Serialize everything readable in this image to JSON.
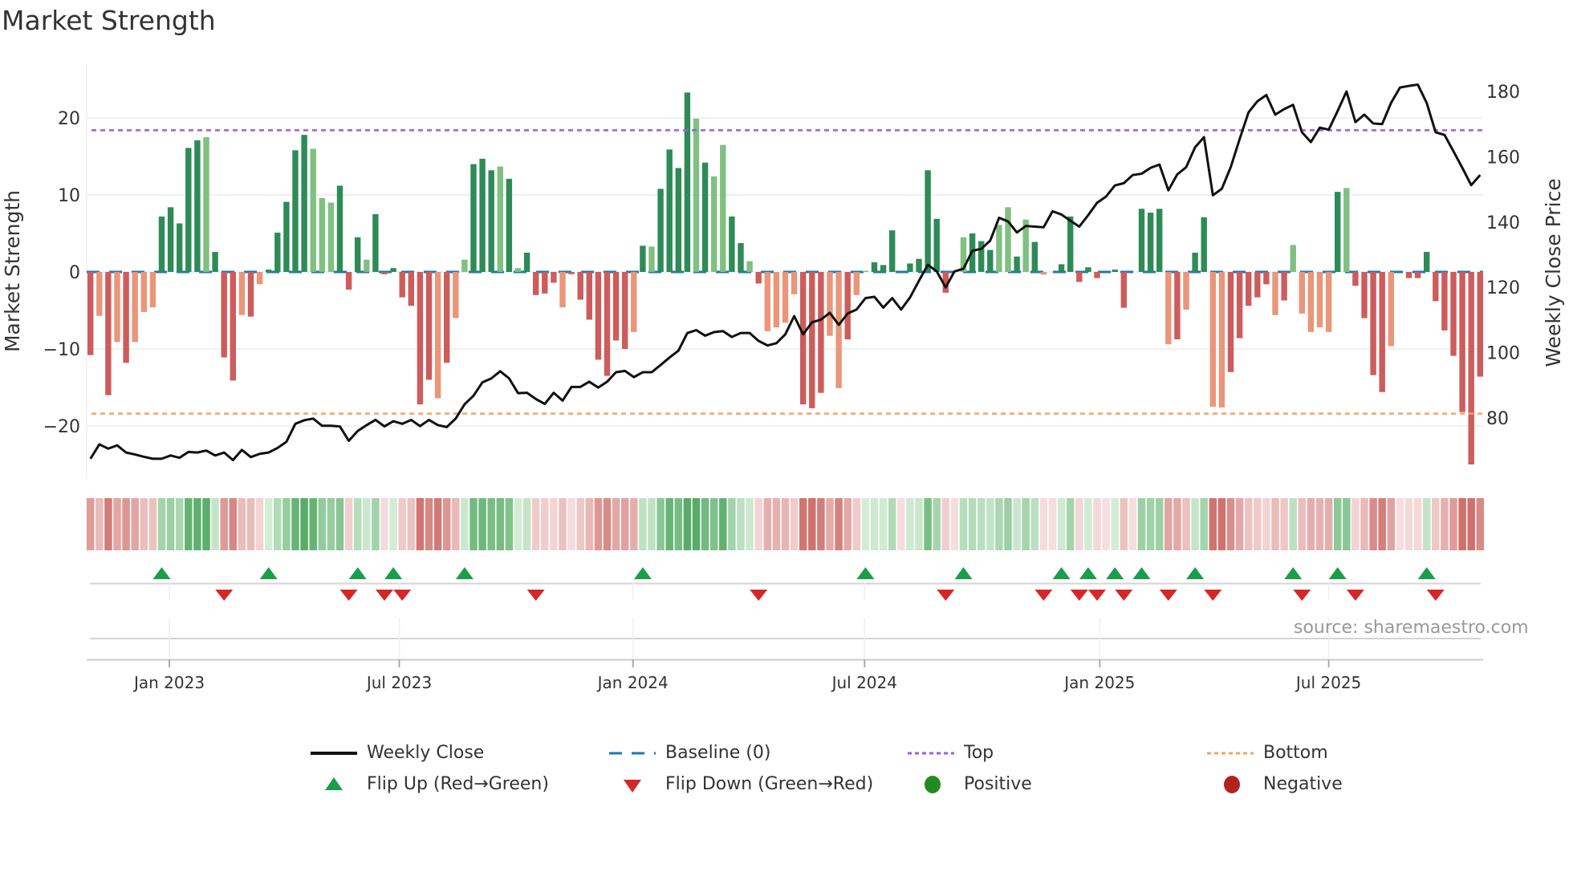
{
  "title": "Market Strength",
  "source": "source: sharemaestro.com",
  "chart_data": {
    "type": "bar",
    "title": "Market Strength",
    "ylabel": "Market Strength",
    "y2label": "Weekly Close Price",
    "ylim": [
      -27,
      27
    ],
    "y2lim": [
      62,
      190
    ],
    "yticks": [
      {
        "v": 20,
        "label": "20"
      },
      {
        "v": 10,
        "label": "10"
      },
      {
        "v": 0,
        "label": "0"
      },
      {
        "v": -10,
        "label": "−10"
      },
      {
        "v": -20,
        "label": "−20"
      }
    ],
    "y2ticks": [
      {
        "v": 180,
        "label": "180"
      },
      {
        "v": 160,
        "label": "160"
      },
      {
        "v": 140,
        "label": "140"
      },
      {
        "v": 120,
        "label": "120"
      },
      {
        "v": 100,
        "label": "100"
      },
      {
        "v": 80,
        "label": "80"
      }
    ],
    "xticks": [
      {
        "week": 8.86,
        "label": "Jan 2023"
      },
      {
        "week": 34.67,
        "label": "Jul 2023"
      },
      {
        "week": 60.9,
        "label": "Jan 2024"
      },
      {
        "week": 86.9,
        "label": "Jul 2024"
      },
      {
        "week": 113.3,
        "label": "Jan 2025"
      },
      {
        "week": 139.0,
        "label": "Jul 2025"
      }
    ],
    "top_level": 18.4,
    "bottom_level": -18.4,
    "baseline": 0,
    "strength": [
      -10.8,
      -5.7,
      -16.0,
      -9.1,
      -11.8,
      -9.1,
      -5.2,
      -4.6,
      7.2,
      8.4,
      6.3,
      16.1,
      17.1,
      17.5,
      2.6,
      -11.1,
      -14.1,
      -5.6,
      -5.8,
      -1.6,
      0.3,
      5.1,
      9.1,
      15.8,
      17.8,
      16.0,
      9.6,
      9.0,
      11.2,
      -2.3,
      4.5,
      1.6,
      7.5,
      -0.3,
      0.5,
      -3.3,
      -4.4,
      -17.2,
      -14.0,
      -16.4,
      -11.8,
      -6.0,
      1.6,
      14.0,
      14.7,
      13.2,
      13.7,
      12.1,
      0.5,
      2.5,
      -3.0,
      -2.8,
      -1.4,
      -4.6,
      -0.3,
      -3.6,
      -6.2,
      -11.4,
      -13.5,
      -8.9,
      -10.0,
      -7.8,
      3.4,
      3.3,
      10.8,
      15.9,
      13.5,
      23.3,
      19.9,
      14.2,
      12.4,
      16.5,
      7.2,
      3.75,
      1.4,
      -1.5,
      -7.7,
      -7.2,
      -6.6,
      -2.9,
      -17.2,
      -17.7,
      -15.7,
      -8.3,
      -15.1,
      -8.75,
      -3.0,
      0.15,
      1.25,
      0.9,
      5.4,
      0,
      1.1,
      1.7,
      13.2,
      6.9,
      -2.7,
      0,
      4.5,
      5.0,
      4.0,
      2.85,
      6.1,
      8.4,
      2.0,
      6.8,
      3.9,
      -0.35,
      0,
      1.0,
      7.2,
      -1.3,
      0.6,
      -0.8,
      0,
      0.3,
      -4.65,
      0,
      8.2,
      7.7,
      8.2,
      -9.4,
      -8.75,
      -4.9,
      2.5,
      7.1,
      -17.5,
      -17.6,
      -13.0,
      -8.6,
      -4.4,
      -3.3,
      -1.6,
      -5.6,
      -3.7,
      3.5,
      -5.4,
      -7.8,
      -7.2,
      -7.8,
      10.4,
      10.9,
      -1.8,
      -6.0,
      -13.4,
      -15.6,
      -9.65,
      0,
      -0.8,
      -0.8,
      2.6,
      -3.8,
      -7.6,
      -10.9,
      -18.2,
      -25.0,
      -13.6
    ],
    "shade": "dldldllldddddldddldldddddllldddldddddddldlldddldlddddldddddddldlddddldllddldlllldddlldlldddlddddddldddlldldldddddddddddddldlddlldddddldllllldlddddldddddddddddl",
    "weekly_close": [
      67.5,
      71.9,
      70.6,
      71.6,
      69.4,
      68.8,
      68.1,
      67.5,
      67.5,
      68.5,
      67.8,
      69.6,
      69.4,
      70.0,
      68.5,
      69.4,
      67.1,
      70.2,
      68.0,
      69.0,
      69.4,
      70.8,
      72.7,
      78.2,
      79.3,
      79.8,
      77.6,
      77.6,
      77.4,
      73.0,
      76.0,
      77.8,
      79.4,
      77.4,
      79.0,
      78.2,
      79.4,
      77.5,
      79.4,
      77.8,
      77.2,
      79.8,
      84.2,
      86.8,
      90.9,
      92.1,
      94.3,
      92.1,
      87.6,
      87.7,
      85.8,
      84.3,
      87.7,
      85.3,
      89.5,
      89.5,
      91.1,
      89.3,
      91.1,
      94.0,
      94.4,
      92.5,
      94.0,
      94.0,
      96.2,
      98.5,
      100.6,
      106.0,
      106.9,
      105.2,
      106.3,
      106.6,
      104.8,
      106.0,
      106.0,
      103.6,
      102.2,
      102.9,
      105.6,
      111.2,
      105.6,
      109.3,
      110.1,
      112.2,
      108.5,
      112.0,
      113.2,
      116.7,
      117.1,
      113.8,
      116.7,
      113.2,
      116.9,
      122.0,
      126.9,
      124.9,
      120.0,
      124.9,
      125.7,
      131.2,
      131.8,
      134.3,
      141.3,
      140.2,
      136.8,
      138.8,
      138.6,
      138.4,
      143.3,
      142.3,
      140.4,
      138.6,
      142.1,
      145.9,
      147.8,
      151.2,
      151.9,
      154.4,
      154.8,
      156.6,
      157.6,
      149.7,
      154.6,
      156.8,
      162.9,
      166.0,
      148.2,
      150.2,
      156.8,
      165.4,
      173.6,
      177.0,
      178.9,
      172.9,
      174.6,
      175.9,
      167.5,
      164.5,
      168.9,
      168.3,
      174.0,
      180.0,
      170.6,
      172.9,
      170.2,
      170.0,
      176.5,
      181.2,
      181.7,
      182.1,
      176.5,
      167.5,
      166.7,
      161.7,
      156.6,
      151.3,
      154.4
    ],
    "flip_up_weeks": [
      9,
      21,
      31,
      35,
      43,
      63,
      88,
      99,
      110,
      113,
      116,
      119,
      125,
      136,
      141,
      151
    ],
    "flip_down_weeks": [
      16,
      30,
      34,
      36,
      51,
      76,
      97,
      108,
      112,
      114,
      117,
      122,
      127,
      137,
      143,
      152
    ],
    "colors": {
      "pos_dark": "#2e8b57",
      "pos_light": "#80c080",
      "neg_dark": "#cd5c5c",
      "neg_light": "#e9967a",
      "baseline": "#1f77b4",
      "top": "#9b5de5",
      "bottom": "#f4a460",
      "close": "#111111",
      "flip_up": "#1a9e4a",
      "flip_down": "#d62728",
      "positive": "#228b22",
      "negative": "#b22222"
    },
    "legend": [
      {
        "key": "close",
        "label": "Weekly Close"
      },
      {
        "key": "baseline",
        "label": "Baseline (0)"
      },
      {
        "key": "top",
        "label": "Top"
      },
      {
        "key": "bottom",
        "label": "Bottom"
      },
      {
        "key": "flip_up",
        "label": "Flip Up (Red→Green)"
      },
      {
        "key": "flip_down",
        "label": "Flip Down (Green→Red)"
      },
      {
        "key": "positive",
        "label": "Positive"
      },
      {
        "key": "negative",
        "label": "Negative"
      }
    ],
    "legend_position": "bottom"
  }
}
